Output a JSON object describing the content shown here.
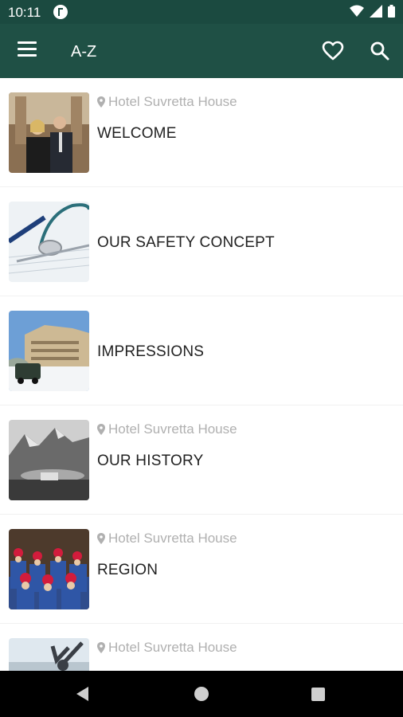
{
  "status_bar": {
    "time": "10:11"
  },
  "app_bar": {
    "title": "A-Z"
  },
  "items": [
    {
      "location": "Hotel Suvretta House",
      "title": "WELCOME"
    },
    {
      "location": "",
      "title": "OUR SAFETY CONCEPT"
    },
    {
      "location": "",
      "title": "IMPRESSIONS"
    },
    {
      "location": "Hotel Suvretta House",
      "title": "OUR HISTORY"
    },
    {
      "location": "Hotel Suvretta House",
      "title": "REGION"
    },
    {
      "location": "Hotel Suvretta House",
      "title": ""
    }
  ],
  "colors": {
    "status_bar": "#1b4a40",
    "app_bar": "#1f5045",
    "location_text": "#b0b0b0"
  }
}
